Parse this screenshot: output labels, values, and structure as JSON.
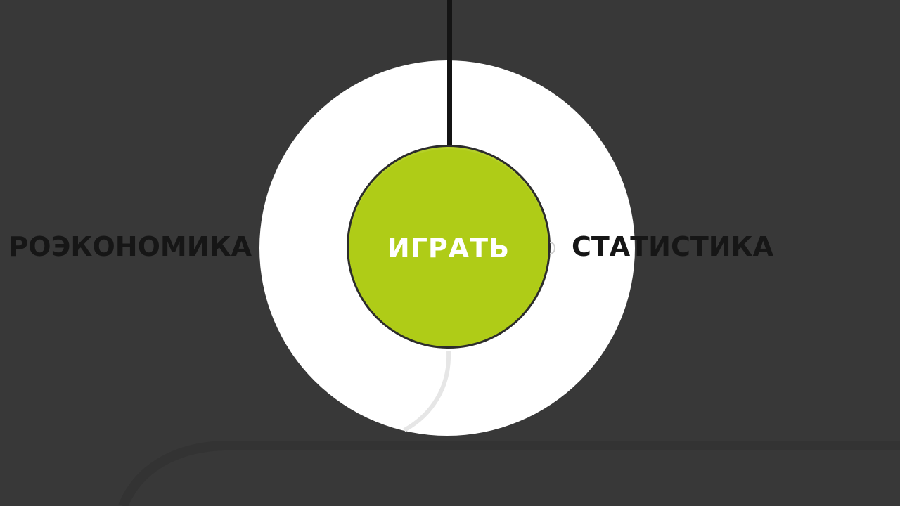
{
  "menu": {
    "play_label": "ИГРАТЬ",
    "left_label": "РОЭКОНОМИКА",
    "right_label": "СТАТИСТИКА"
  },
  "colors": {
    "background": "#383838",
    "accent": "#afcc17",
    "ring": "#ffffff",
    "text_dark": "#161616"
  },
  "icons": {
    "connector": "vertical-line",
    "track": "curved-path"
  }
}
